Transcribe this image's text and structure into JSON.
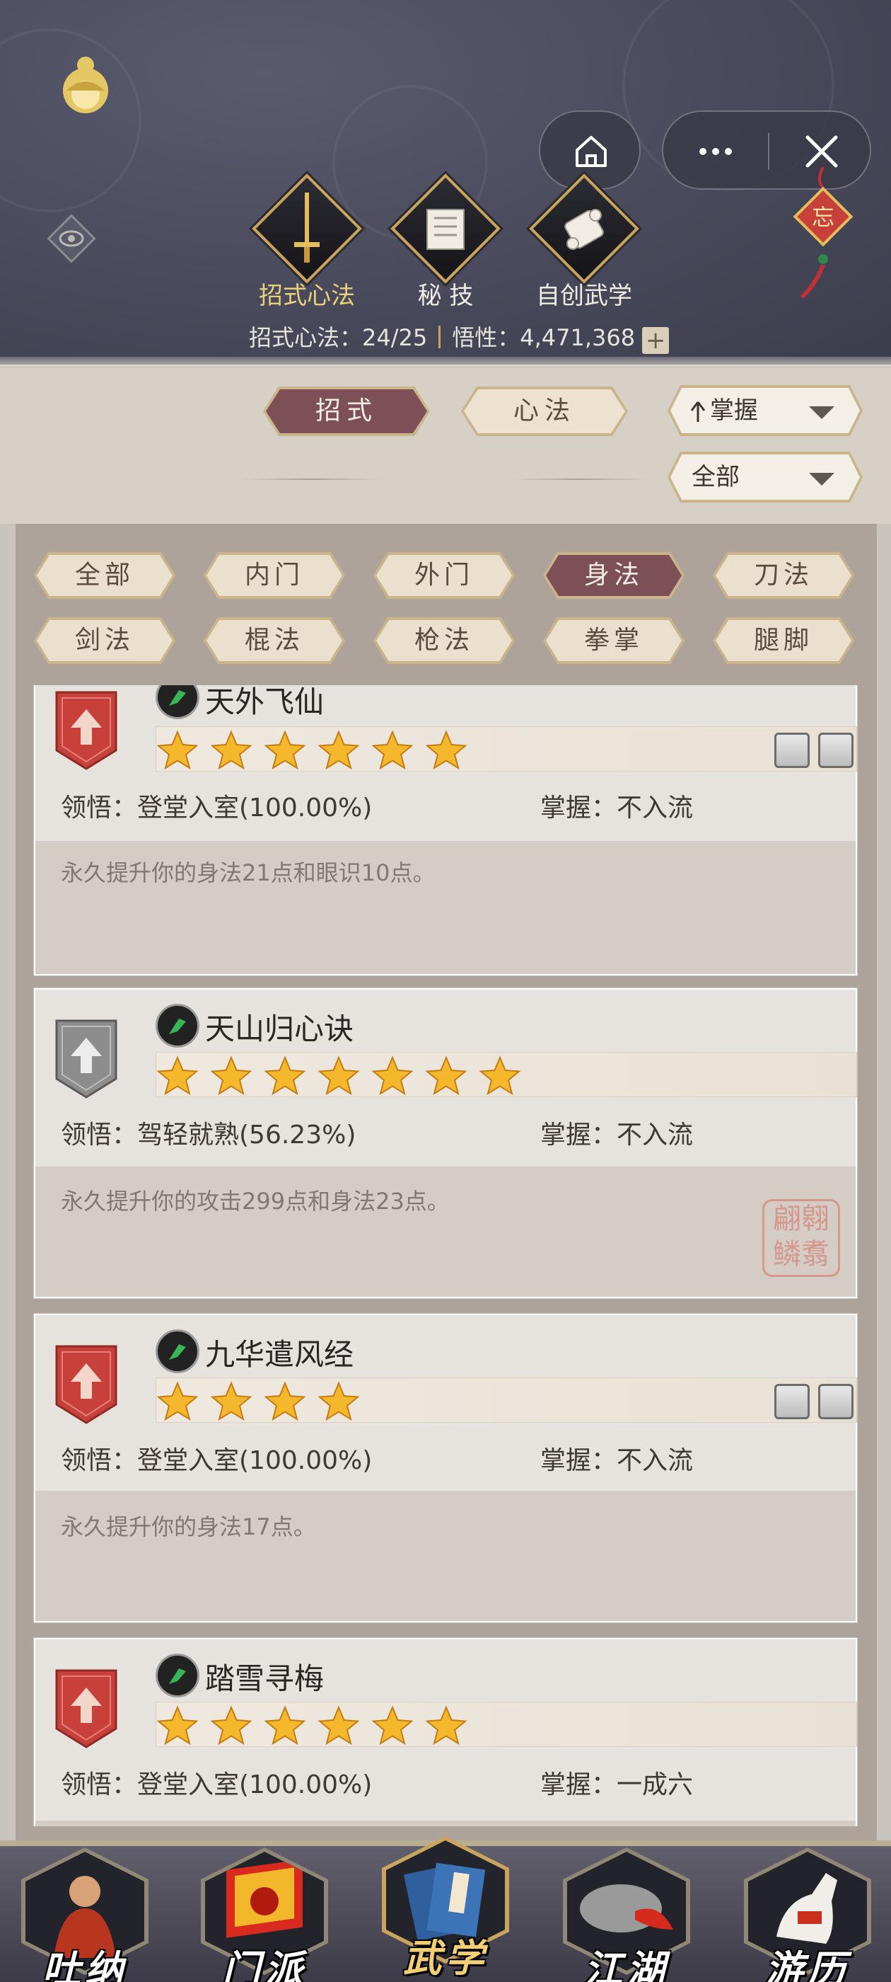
{
  "header": {
    "tabs": [
      {
        "label": "招式心法",
        "active": true
      },
      {
        "label": "秘 技",
        "active": false
      },
      {
        "label": "自创武学",
        "active": false
      }
    ],
    "stats_label": "招式心法：24/25",
    "comprehension_label": "悟性：4,471,368",
    "plus": "+",
    "charm_text": "忘"
  },
  "filters": {
    "type_tabs": [
      "招式",
      "心法"
    ],
    "active_type": "招式",
    "sort_value": "掌握",
    "scope_value": "全部",
    "categories": [
      "全部",
      "内门",
      "外门",
      "身法",
      "刀法",
      "剑法",
      "棍法",
      "枪法",
      "拳掌",
      "腿脚"
    ],
    "active_category": "身法"
  },
  "cards": [
    {
      "name": "天外飞仙",
      "stars": 6,
      "badge": "red",
      "skill_icons": 2,
      "comprehension": "领悟：登堂入室(100.00%)",
      "mastery": "掌握：不入流",
      "desc": "永久提升你的身法21点和眼识10点。"
    },
    {
      "name": "天山归心诀",
      "stars": 7,
      "badge": "gray",
      "skill_icons": 0,
      "comprehension": "领悟：驾轻就熟(56.23%)",
      "mastery": "掌握：不入流",
      "desc": "永久提升你的攻击299点和身法23点。",
      "seal": "翩翱\n鳞翥"
    },
    {
      "name": "九华遣风经",
      "stars": 4,
      "badge": "red",
      "skill_icons": 2,
      "comprehension": "领悟：登堂入室(100.00%)",
      "mastery": "掌握：不入流",
      "desc": "永久提升你的身法17点。"
    },
    {
      "name": "踏雪寻梅",
      "stars": 6,
      "badge": "red",
      "skill_icons": 0,
      "comprehension": "领悟：登堂入室(100.00%)",
      "mastery": "掌握：一成六",
      "desc": ""
    }
  ],
  "bottom_nav": [
    {
      "label": "吐纳",
      "active": false
    },
    {
      "label": "门派",
      "active": false
    },
    {
      "label": "武学",
      "active": true
    },
    {
      "label": "江湖",
      "active": false
    },
    {
      "label": "游历",
      "active": false
    }
  ],
  "colors": {
    "header_bg": "#474859",
    "active_pill": "#7d4f56",
    "gold": "#c9a45c",
    "badge_red": "#c8403a",
    "badge_gray": "#8d8d8d"
  }
}
